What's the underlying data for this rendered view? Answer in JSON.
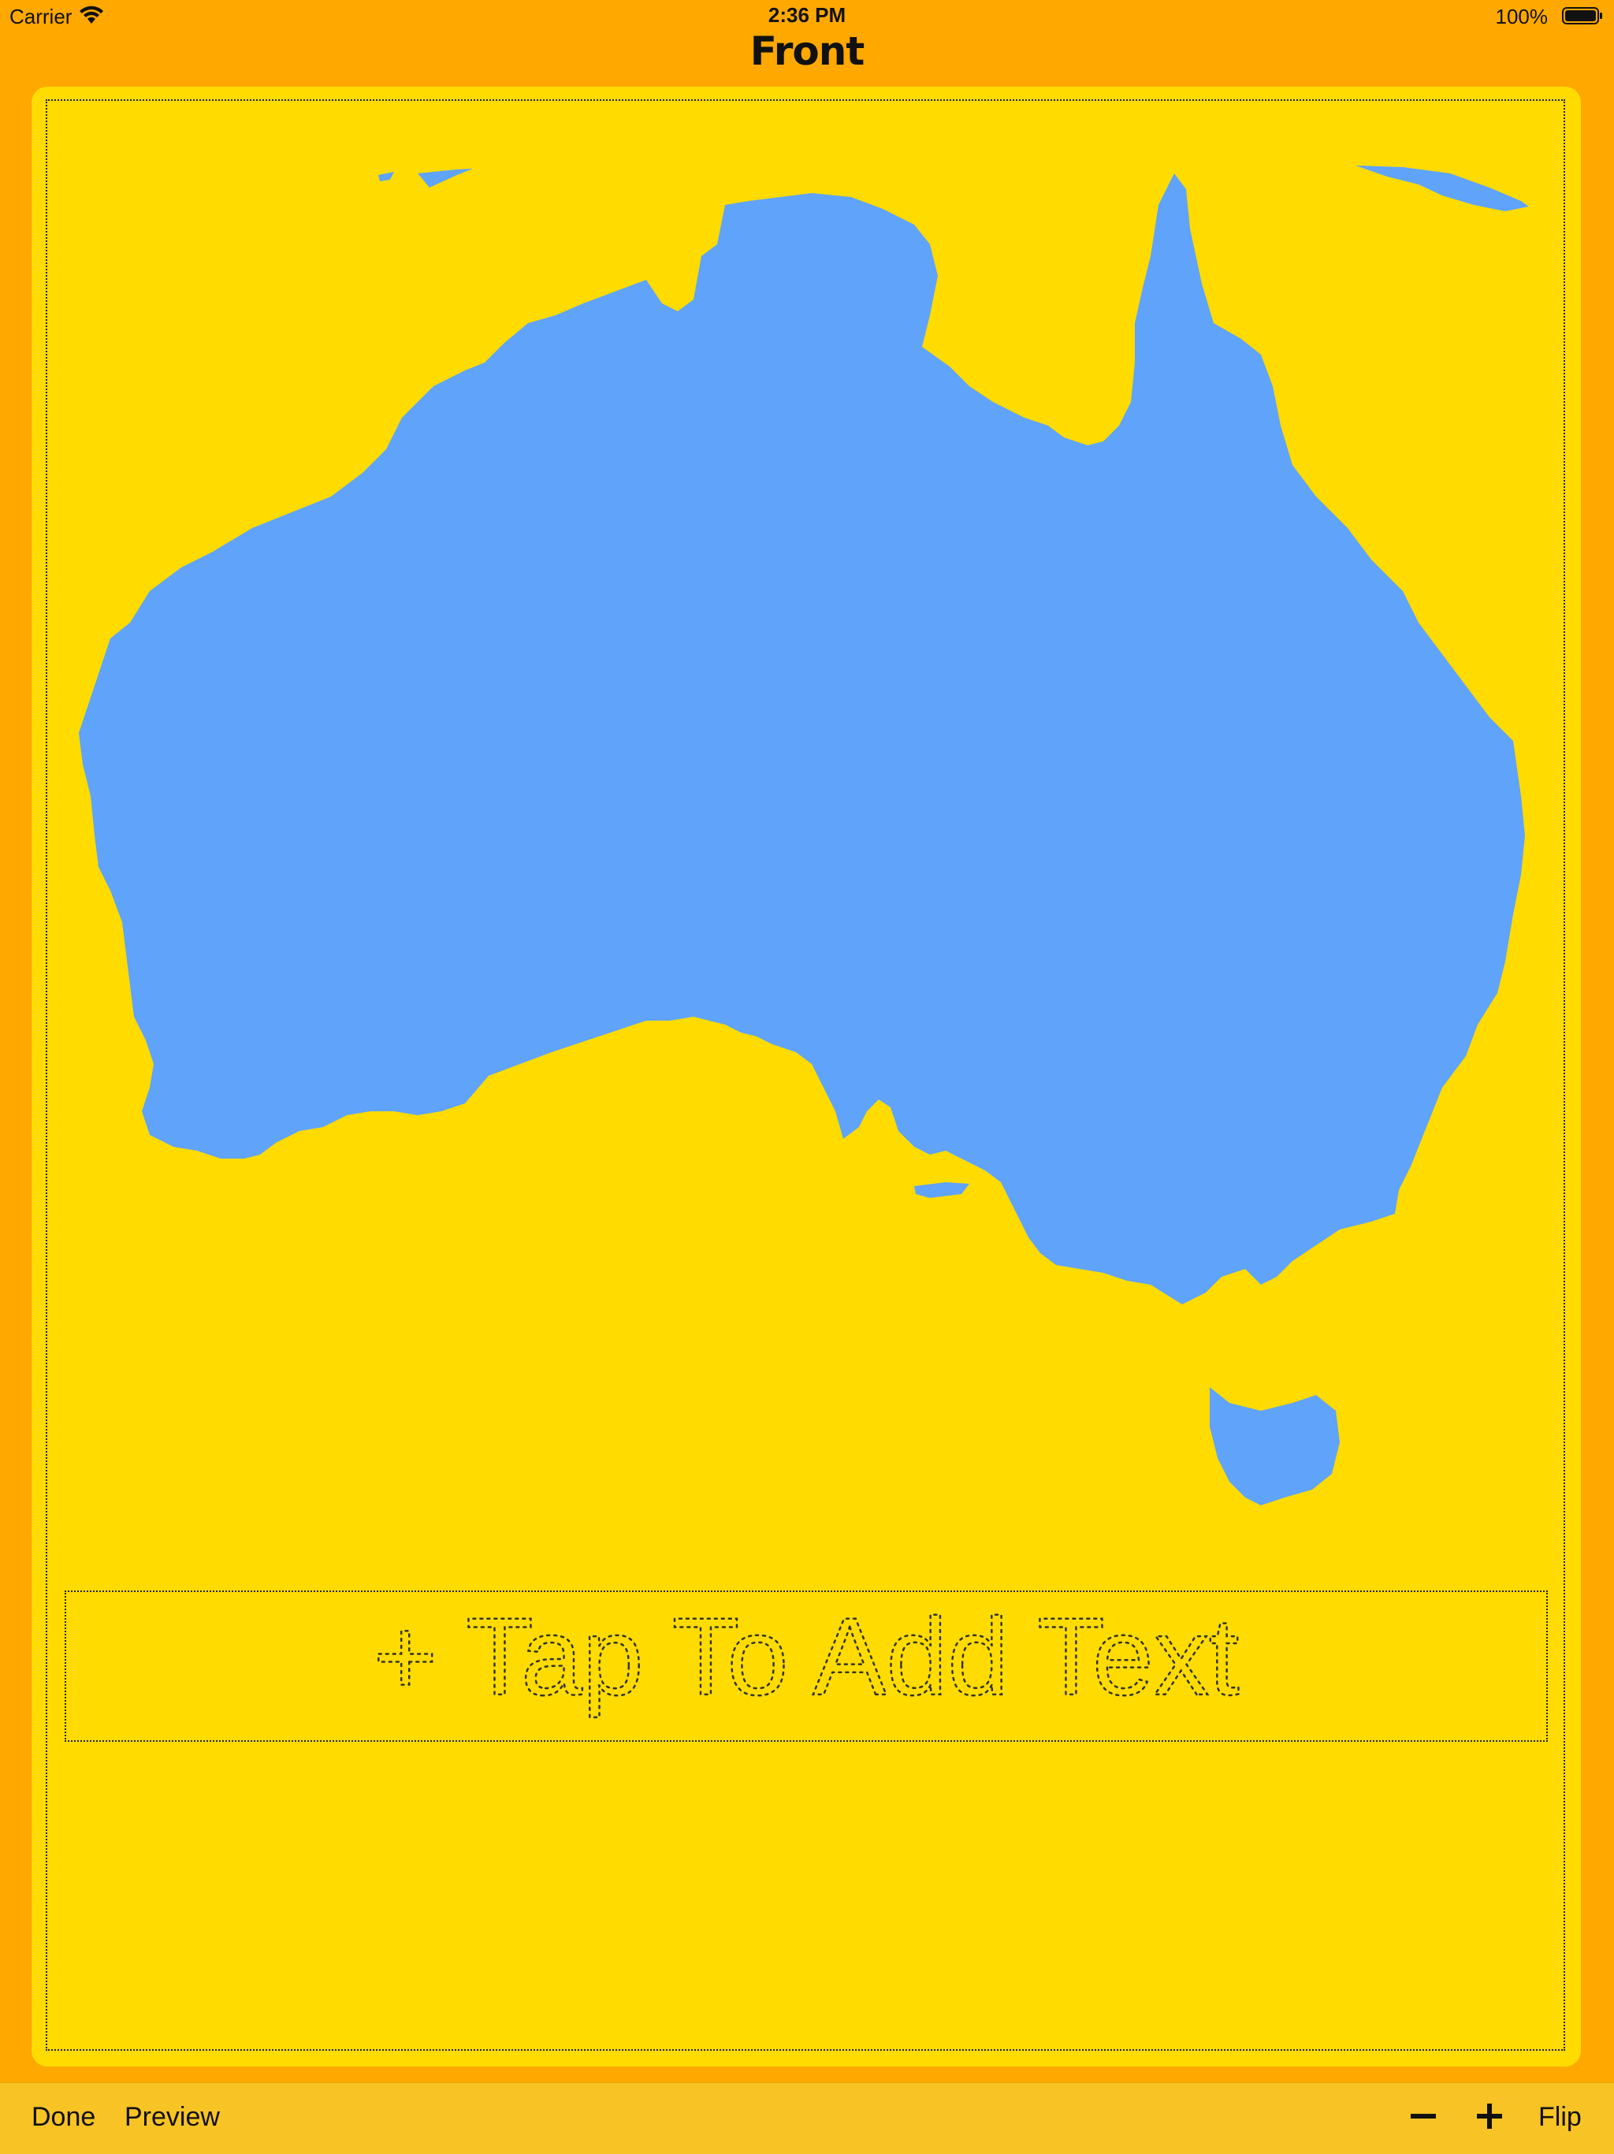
{
  "status_bar": {
    "carrier": "Carrier",
    "time": "2:36 PM",
    "battery_percent": "100%",
    "wifi_icon": "wifi-icon",
    "battery_icon": "battery-full-icon"
  },
  "header": {
    "title": "Front"
  },
  "card": {
    "background_color": "#FFDB00",
    "land_color": "#5FA3FA",
    "image": "australia-map",
    "text_placeholder": "+ Tap To Add Text"
  },
  "toolbar": {
    "done_label": "Done",
    "preview_label": "Preview",
    "decrease_icon": "minus-icon",
    "increase_icon": "plus-icon",
    "flip_label": "Flip"
  },
  "colors": {
    "app_background": "#FFA800",
    "toolbar_background": "#F8C325"
  }
}
